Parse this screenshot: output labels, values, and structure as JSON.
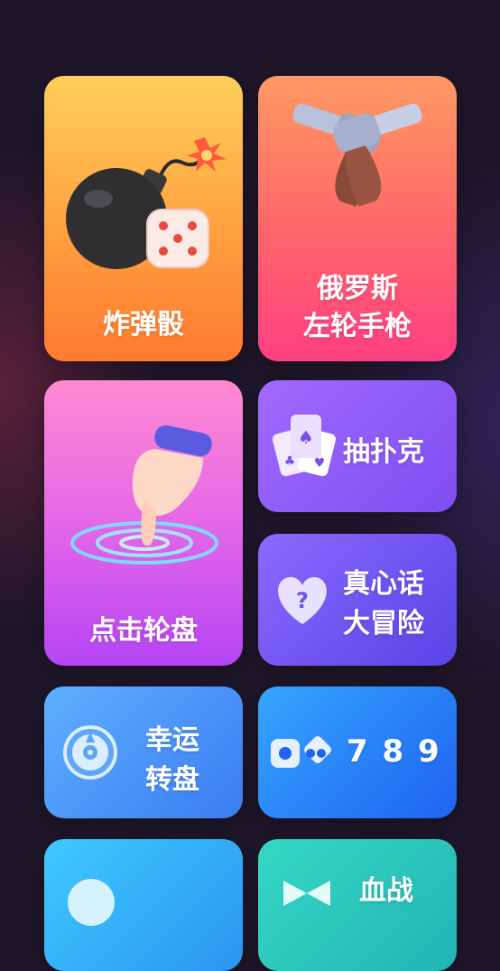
{
  "games": {
    "bomb_dice": {
      "label": "炸弹骰",
      "icon": "bomb-dice-icon"
    },
    "russian_roulette": {
      "line1": "俄罗斯",
      "line2": "左轮手枪",
      "icon": "revolvers-icon"
    },
    "tap_wheel": {
      "label": "点击轮盘",
      "icon": "tap-finger-icon"
    },
    "draw_poker": {
      "label": "抽扑克",
      "icon": "playing-cards-icon"
    },
    "truth_or_dare": {
      "line1": "真心话",
      "line2": "大冒险",
      "icon": "question-heart-icon"
    },
    "lucky_wheel": {
      "line1": "幸运",
      "line2": "转盘",
      "icon": "spin-wheel-icon"
    },
    "game_789": {
      "label": "7 8 9",
      "icon": "dice-pair-icon"
    },
    "bottom_right": {
      "label": "血战",
      "icon": "bow-icon"
    }
  }
}
